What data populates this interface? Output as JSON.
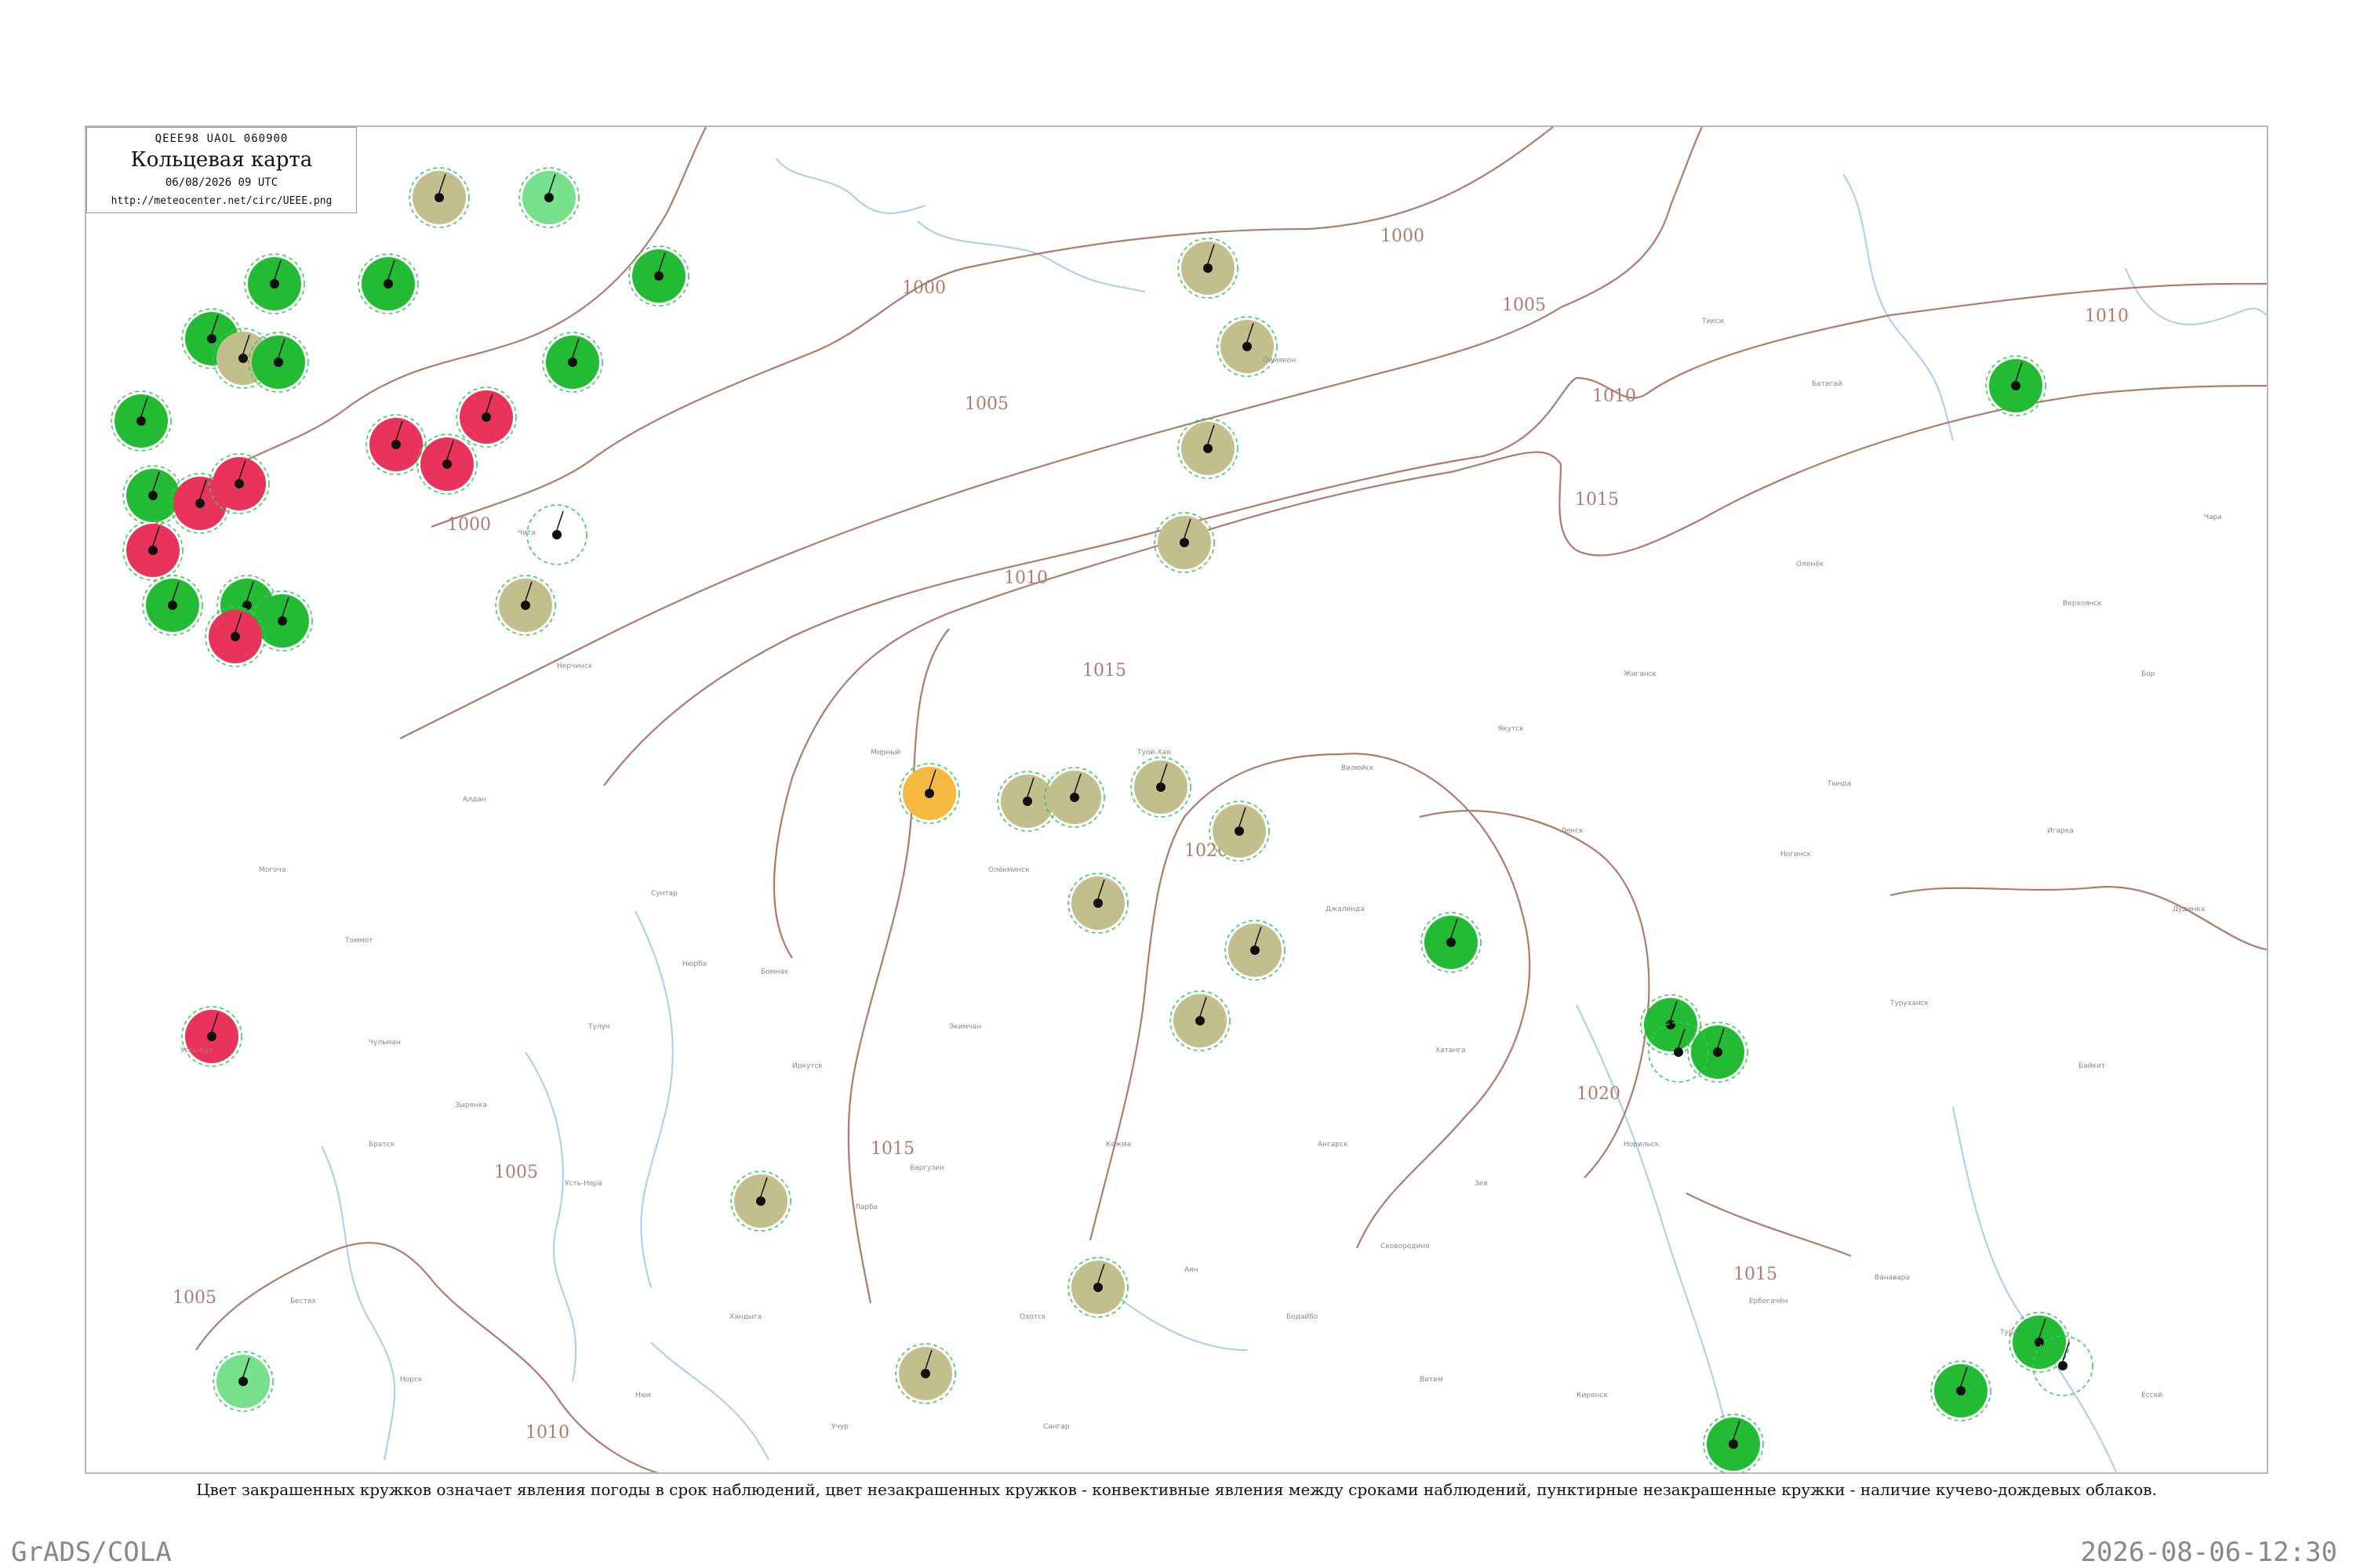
{
  "title_box": {
    "code": "QEEE98  UAOL  060900",
    "name": "Кольцевая карта",
    "datetime": "06/08/2026 09 UTC",
    "url": "http://meteocenter.net/circ/UEEE.png"
  },
  "legend_caption": "Цвет закрашенных кружков означает явления погоды в срок наблюдений, цвет незакрашенных кружков - конвективные явления между сроками наблюдений, пунктирные незакрашенные кружки - наличие кучево-дождевых облаков.",
  "footer": {
    "left": "GrADS/COLA",
    "right": "2026-08-06-12:30"
  },
  "colors": {
    "isobar": "#b07a6e",
    "river": "#a9cdf0",
    "rain": "#22bb33",
    "thunder": "#e8335a",
    "dust_haze": "#c2bf8c",
    "fog_orange": "#f5b942",
    "light_green": "#77e08c",
    "cb_ring": "#33cc55"
  },
  "isobars": [
    "1000",
    "1005",
    "1010",
    "1015",
    "1020"
  ],
  "station_names": [
    "Оймякон",
    "Батагай",
    "Тикси",
    "Верхоянск",
    "Жиганск",
    "Оленёк",
    "Туой-Хая",
    "Вилюйск",
    "Якутск",
    "Олёкминск",
    "Ленск",
    "Мирный",
    "Сунтар",
    "Нюрба",
    "Алдан",
    "Томмот",
    "Чульман",
    "Зырянка",
    "Усть-Нера",
    "Хандыга",
    "Учур",
    "Охотск",
    "Аян",
    "Бодайбо",
    "Витим",
    "Киренск",
    "Ербогачён",
    "Ванавара",
    "Тура",
    "Ессей",
    "Туруханск",
    "Бор",
    "Байкит",
    "Чара",
    "Тында",
    "Зея",
    "Сковородино",
    "Нерчинск",
    "Чита",
    "Могоча",
    "Усть-Кут",
    "Братск",
    "Тулун",
    "Иркутск",
    "Баргузин",
    "Кежма",
    "Ангарск",
    "Хатанга",
    "Норильск",
    "Игарка",
    "Дудинка",
    "Ногинск",
    "Джалинда",
    "Экимчан",
    "Бомнак",
    "Ларба",
    "Норск",
    "Бестях",
    "Нюя",
    "Сангар"
  ],
  "weather_symbols": [
    "rain-dot",
    "thunder-triangle",
    "fog-lines",
    "cloud-cover-circle",
    "wind-barb"
  ]
}
